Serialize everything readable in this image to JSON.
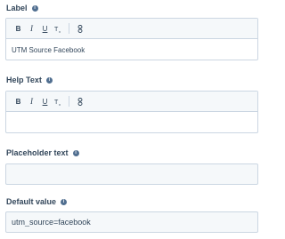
{
  "fields": [
    {
      "label": "Label",
      "value": "UTM Source Facebook"
    },
    {
      "label": "Help Text",
      "value": ""
    },
    {
      "label": "Placeholder text",
      "value": ""
    },
    {
      "label": "Default value",
      "value": "utm_source=facebook"
    }
  ],
  "toolbar": {
    "bold": "B",
    "italic": "I",
    "underline": "U",
    "clear_format": "T̲ₓ",
    "link": "8"
  },
  "icons": {
    "info": "info-icon",
    "bold": "bold-icon",
    "italic": "italic-icon",
    "underline": "underline-icon",
    "clear_format": "clear-format-icon",
    "link": "link-icon"
  },
  "colors": {
    "text": "#33475b",
    "border": "#cbd6e2",
    "input_bg": "#f5f8fa",
    "info_icon": "#516f90"
  }
}
